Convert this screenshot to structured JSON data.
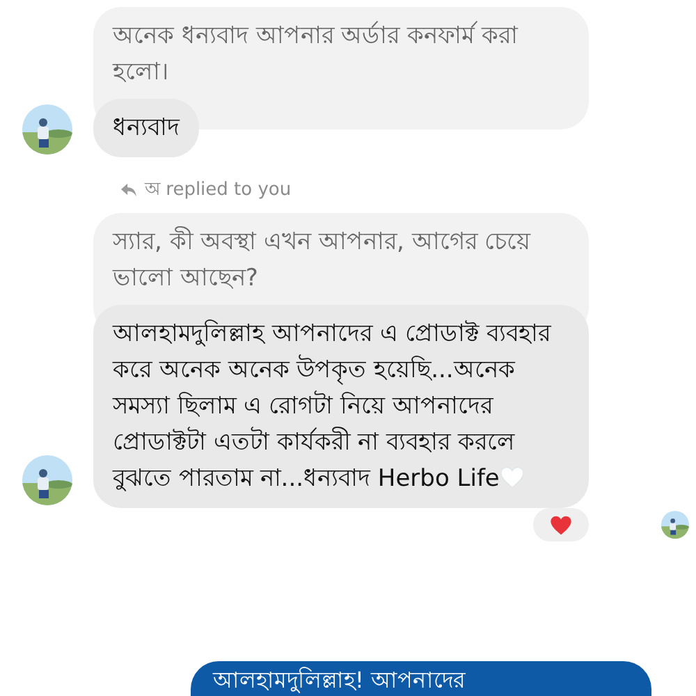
{
  "messages": [
    {
      "kind": "incoming_reply",
      "quoted": "অনেক ধন্যবাদ আপনার অর্ডার কনফার্ম করা হলো।",
      "text": "ধন্যবাদ",
      "trailing_heart": false,
      "reacted": false,
      "seen": false
    },
    {
      "kind": "incoming_reply",
      "reply_note": "অ replied to you",
      "quoted": "স্যার, কী অবস্থা এখন আপনার, আগের চেয়ে ভালো আছেন?",
      "text": "আলহামদুলিল্লাহ আপনাদের এ প্রোডাক্ট ব্যবহার করে অনেক অনেক উপকৃত হয়েছি...অনেক সমস্যা ছিলাম এ রোগটা নিয়ে আপনাদের প্রোডাক্টটা এতটা কার্যকরী না ব্যবহার করলে বুঝতে পারতাম না...ধন্যবাদ Herbo Life",
      "trailing_heart": true,
      "reacted": true,
      "seen": true
    },
    {
      "kind": "outgoing",
      "text": "আলহামদুলিল্লাহ! আপনাদের"
    }
  ]
}
